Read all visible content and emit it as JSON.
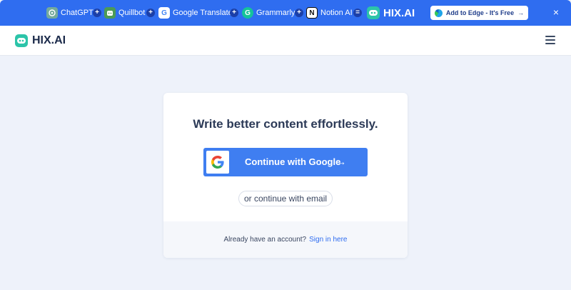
{
  "banner": {
    "tools": [
      {
        "label": "ChatGPT",
        "icon": "chatgpt-icon"
      },
      {
        "label": "Quillbot",
        "icon": "quillbot-icon"
      },
      {
        "label": "Google Translate",
        "icon": "google-translate-icon"
      },
      {
        "label": "Grammarly",
        "icon": "grammarly-icon"
      },
      {
        "label": "Notion AI",
        "icon": "notion-icon"
      }
    ],
    "plus_symbol": "+",
    "equals_symbol": "=",
    "result_brand": "HIX.AI",
    "cta_label": "Add to Edge - It's Free",
    "cta_arrow": "→",
    "close_symbol": "×",
    "colors": {
      "background": "#2f6df0",
      "separator": "#1b3fa8"
    }
  },
  "header": {
    "brand": "HIX.AI",
    "menu_icon": "hamburger-menu-icon"
  },
  "card": {
    "title": "Write better content effortlessly.",
    "google_button_label": "Continue with Google",
    "google_button_arrow": "→",
    "email_button_label": "or continue with email",
    "footer_text": "Already have an account?",
    "signin_link": "Sign in here",
    "colors": {
      "accent": "#3f7ef1",
      "brand": "#2cc4a9"
    }
  }
}
